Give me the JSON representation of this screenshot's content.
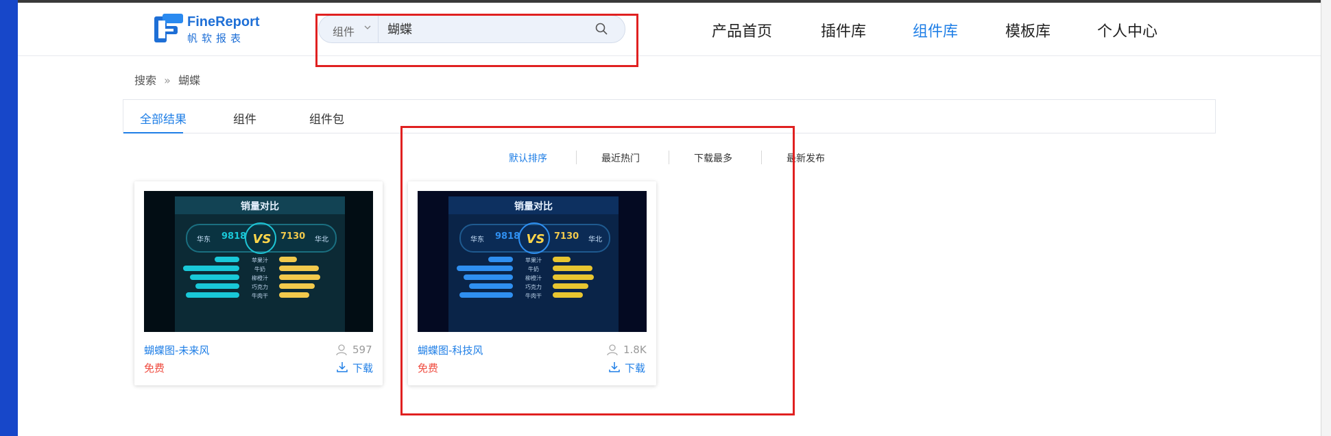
{
  "header": {
    "logo_name": "FineReport",
    "logo_sub": "帆软报表",
    "search": {
      "type_label": "组件",
      "value": "蝴蝶"
    },
    "nav": [
      "产品首页",
      "插件库",
      "组件库",
      "模板库",
      "个人中心"
    ],
    "nav_active": "组件库"
  },
  "breadcrumb": {
    "root": "搜索",
    "separator": "»",
    "current": "蝴蝶"
  },
  "tabs": [
    "全部结果",
    "组件",
    "组件包"
  ],
  "tab_active": "全部结果",
  "sort": [
    "默认排序",
    "最近热门",
    "下载最多",
    "最新发布"
  ],
  "sort_active": "默认排序",
  "cards": [
    {
      "title": "蝴蝶图-未来风",
      "price": "免费",
      "count": "597",
      "download": "下载",
      "thumb": {
        "title": "销量对比",
        "left_name": "华东",
        "left_value": "9818",
        "right_name": "华北",
        "right_value": "7130",
        "vs": "VS",
        "rows": [
          "苹果汁",
          "牛奶",
          "柳橙汁",
          "巧克力",
          "牛肉干"
        ],
        "left_color": "#19c8d8",
        "right_color": "#f2c94c"
      }
    },
    {
      "title": "蝴蝶图-科技风",
      "price": "免费",
      "count": "1.8K",
      "download": "下载",
      "thumb": {
        "title": "销量对比",
        "left_name": "华东",
        "left_value": "9818",
        "right_name": "华北",
        "right_value": "7130",
        "vs": "VS",
        "rows": [
          "苹果汁",
          "牛奶",
          "柳橙汁",
          "巧克力",
          "牛肉干"
        ],
        "left_color": "#2f8ff0",
        "right_color": "#e8c530"
      }
    }
  ],
  "colors": {
    "accent": "#1e7ee6",
    "price": "#ef4b3f",
    "annotation": "#e02020"
  }
}
